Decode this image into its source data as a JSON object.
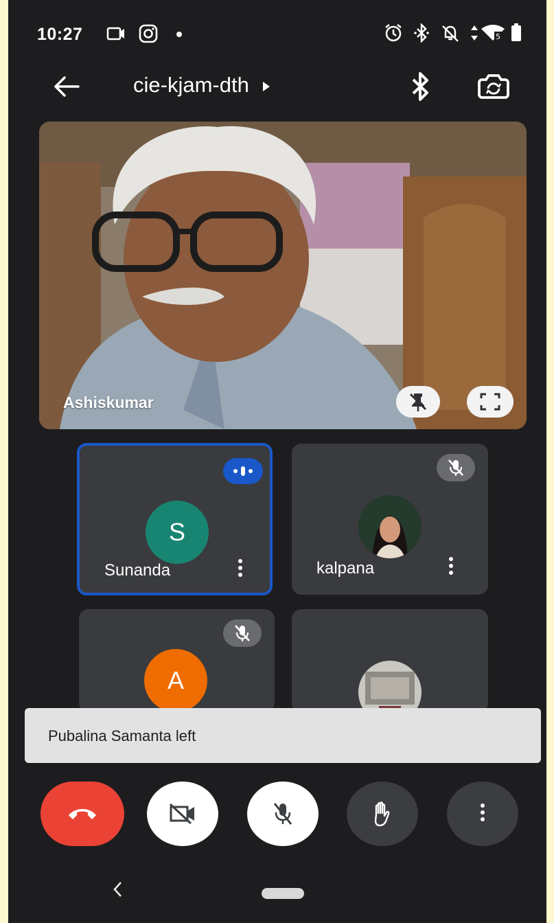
{
  "status_bar": {
    "time": "10:27",
    "left_icons": [
      "video-call-notification-icon",
      "instagram-icon",
      "dot-icon"
    ],
    "right_icons": [
      "alarm-icon",
      "bluetooth-icon",
      "do-not-disturb-icon",
      "data-arrows-icon",
      "wifi-icon",
      "battery-icon"
    ]
  },
  "top_bar": {
    "meeting_code": "cie-kjam-dth",
    "icons": [
      "back-arrow-icon",
      "caret-right-icon",
      "bluetooth-icon",
      "switch-camera-icon"
    ]
  },
  "main_video": {
    "participant_name": "Ashiskumar",
    "icons": [
      "unpin-icon",
      "fullscreen-icon"
    ]
  },
  "participants": [
    {
      "name": "Sunanda",
      "initial": "S",
      "avatar_color": "#188572",
      "state": "speaking"
    },
    {
      "name": "kalpana",
      "initial": "",
      "avatar": "photo",
      "state": "muted"
    },
    {
      "name": "",
      "initial": "A",
      "avatar_color": "#ef6c00",
      "state": "muted"
    },
    {
      "name": "",
      "initial": "",
      "avatar": "photo",
      "state": ""
    }
  ],
  "toast": {
    "message": "Pubalina Samanta left"
  },
  "controls": [
    "end-call-icon",
    "camera-off-icon",
    "mic-off-icon",
    "raise-hand-icon",
    "more-options-icon"
  ],
  "colors": {
    "background": "#1d1d1f",
    "tile": "#3a3b3e",
    "speaking_border": "#1a57c9",
    "end_call": "#ea4335",
    "active_speaker_badge": "#1a57c9",
    "toast_bg": "#e2e2e2",
    "frame": "#fdf8cf"
  }
}
